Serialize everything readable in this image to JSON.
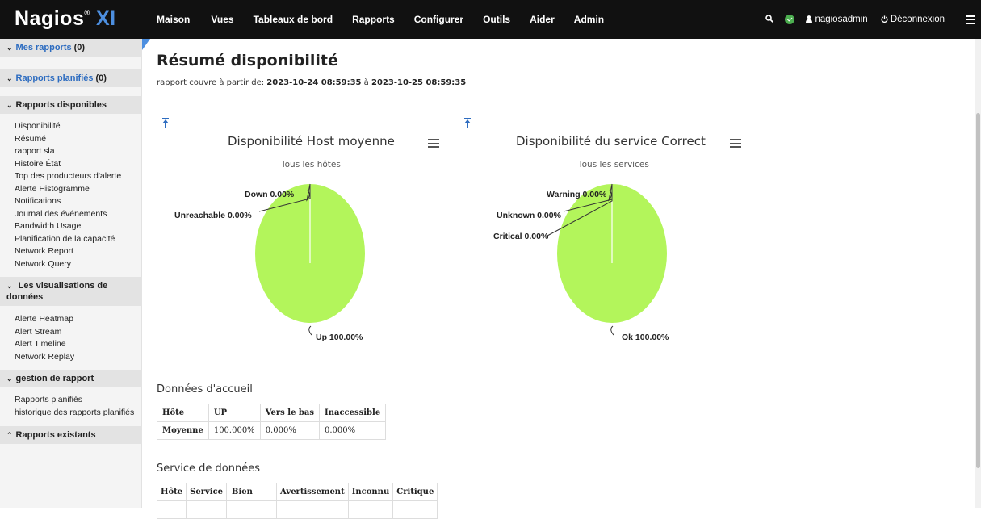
{
  "app": {
    "logo_main": "Nagios",
    "logo_suffix": "XI"
  },
  "nav": {
    "items": [
      "Maison",
      "Vues",
      "Tableaux de bord",
      "Rapports",
      "Configurer",
      "Outils",
      "Aider",
      "Admin"
    ],
    "user": "nagiosadmin",
    "logout": "Déconnexion"
  },
  "sidebar": {
    "my_reports": {
      "label": "Mes rapports",
      "count": "(0)"
    },
    "scheduled": {
      "label": "Rapports planifiés",
      "count": "(0)"
    },
    "available": {
      "label": "Rapports disponibles",
      "items": [
        "Disponibilité",
        "Résumé",
        "rapport sla",
        "Histoire État",
        "Top des producteurs d'alerte",
        "Alerte Histogramme",
        "Notifications",
        "Journal des événements",
        "Bandwidth Usage",
        "Planification de la capacité",
        "Network Report",
        "Network Query"
      ]
    },
    "visualizations": {
      "label_line1": "Les visualisations de",
      "label_line2": "données",
      "items": [
        "Alerte Heatmap",
        "Alert Stream",
        "Alert Timeline",
        "Network Replay"
      ]
    },
    "management": {
      "label": "gestion de rapport",
      "items": [
        "Rapports planifiés",
        "historique des rapports planifiés"
      ]
    },
    "existing": {
      "label": "Rapports existants"
    }
  },
  "page": {
    "title": "Résumé disponibilité",
    "range_prefix": "rapport couvre à partir de: ",
    "range_start": "2023-10-24 08:59:35",
    "range_sep": " à ",
    "range_end": "2023-10-25 08:59:35"
  },
  "chart_data": [
    {
      "type": "pie",
      "title": "Disponibilité Host moyenne",
      "subtitle": "Tous les hôtes",
      "slices": [
        {
          "label": "Up",
          "value": 100.0,
          "text": "Up 100.00%"
        },
        {
          "label": "Down",
          "value": 0.0,
          "text": "Down 0.00%"
        },
        {
          "label": "Unreachable",
          "value": 0.0,
          "text": "Unreachable 0.00%"
        }
      ],
      "color": "#b3f55b"
    },
    {
      "type": "pie",
      "title": "Disponibilité du service Correct",
      "subtitle": "Tous les services",
      "slices": [
        {
          "label": "Ok",
          "value": 100.0,
          "text": "Ok 100.00%"
        },
        {
          "label": "Warning",
          "value": 0.0,
          "text": "Warning 0.00%"
        },
        {
          "label": "Unknown",
          "value": 0.0,
          "text": "Unknown 0.00%"
        },
        {
          "label": "Critical",
          "value": 0.0,
          "text": "Critical 0.00%"
        }
      ],
      "color": "#b3f55b"
    }
  ],
  "host_table": {
    "title": "Données d'accueil",
    "headers": [
      "Hôte",
      "UP",
      "Vers le bas",
      "Inaccessible"
    ],
    "row": [
      "Moyenne",
      "100.000%",
      "0.000%",
      "0.000%"
    ]
  },
  "service_table": {
    "title": "Service de données",
    "headers": [
      "Hôte",
      "Service",
      "Bien",
      "Avertissement",
      "Inconnu",
      "Critique"
    ]
  }
}
